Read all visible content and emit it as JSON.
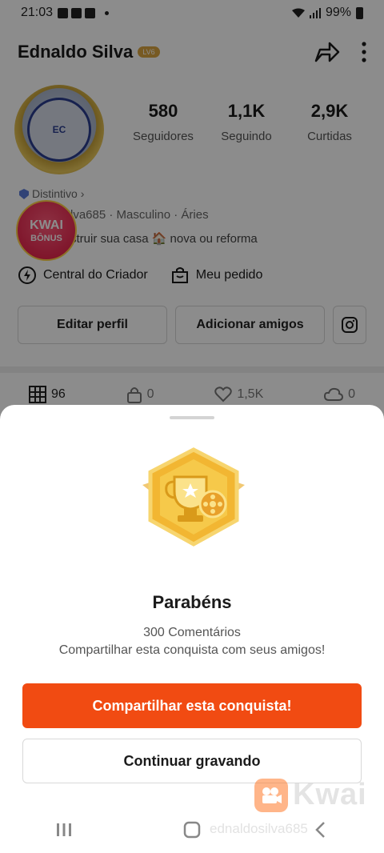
{
  "status_bar": {
    "time": "21:03",
    "battery": "99%"
  },
  "profile": {
    "name": "Ednaldo Silva",
    "badge": "LV6",
    "avatar_text": "EC",
    "stats": [
      {
        "value": "580",
        "label": "Seguidores"
      },
      {
        "value": "1,1K",
        "label": "Seguindo"
      },
      {
        "value": "2,9K",
        "label": "Curtidas"
      }
    ],
    "distintivo": "Distintivo",
    "info": "lva685 · Masculino · Áries",
    "bio": "struir sua casa 🏠 nova ou reforma",
    "kwai_bonus": {
      "line1": "KWAI",
      "line2": "BÔNUS"
    },
    "links": {
      "creator": "Central do Criador",
      "orders": "Meu pedido"
    },
    "buttons": {
      "edit": "Editar perfil",
      "add_friends": "Adicionar amigos"
    },
    "tabs": [
      {
        "icon": "grid-icon",
        "count": "96"
      },
      {
        "icon": "lock-icon",
        "count": "0"
      },
      {
        "icon": "heart-icon",
        "count": "1,5K"
      },
      {
        "icon": "cloud-icon",
        "count": "0"
      }
    ]
  },
  "sheet": {
    "title": "Parabéns",
    "subtitle": "300 Comentários",
    "message": "Compartilhar esta conquista com seus amigos!",
    "share_button": "Compartilhar esta conquista!",
    "continue_button": "Continuar gravando"
  },
  "watermark": {
    "brand": "Kwai",
    "handle": "ednaldosilva685"
  },
  "colors": {
    "accent": "#f14b12",
    "gold": "#f2b632"
  }
}
